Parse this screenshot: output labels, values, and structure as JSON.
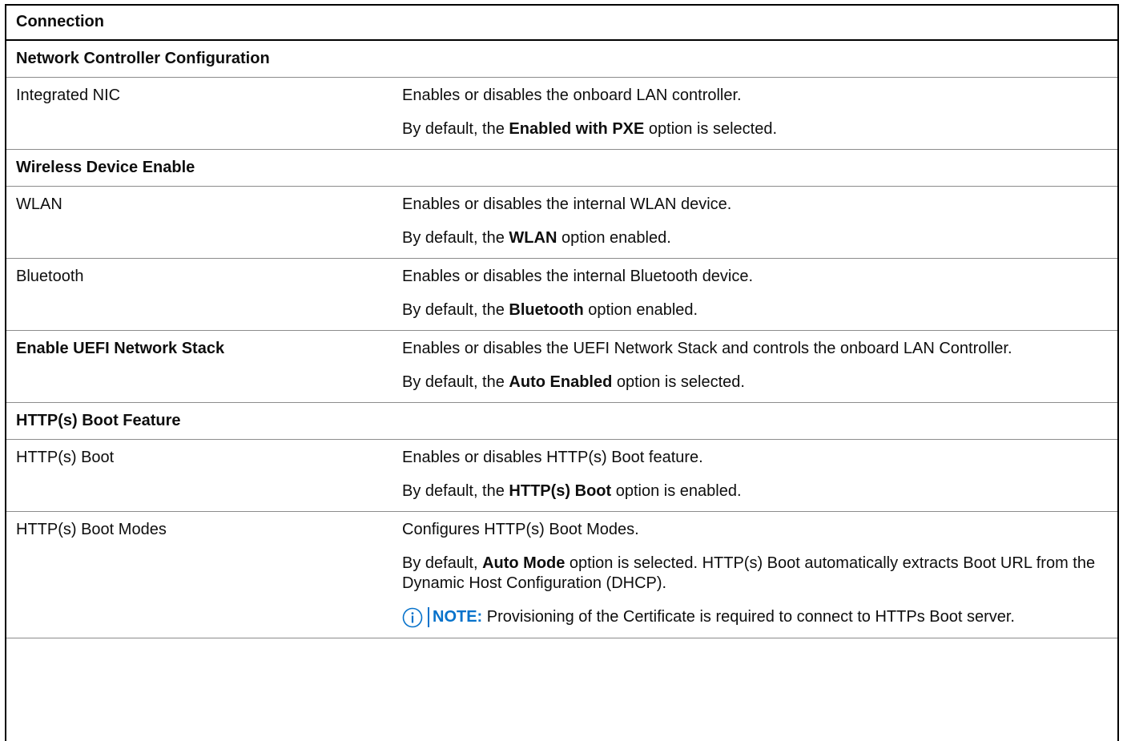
{
  "table": {
    "header": "Connection",
    "sections": [
      {
        "title": "Network Controller Configuration",
        "rows": [
          {
            "name": "Integrated NIC",
            "name_bold": false,
            "paragraphs": [
              {
                "pre": "Enables or disables the onboard LAN controller.",
                "bold": "",
                "post": ""
              },
              {
                "pre": "By default, the ",
                "bold": "Enabled with PXE",
                "post": " option is selected."
              }
            ]
          }
        ]
      },
      {
        "title": "Wireless Device Enable",
        "rows": [
          {
            "name": "WLAN",
            "name_bold": false,
            "paragraphs": [
              {
                "pre": "Enables or disables the internal WLAN device.",
                "bold": "",
                "post": ""
              },
              {
                "pre": "By default, the ",
                "bold": "WLAN",
                "post": " option enabled."
              }
            ]
          },
          {
            "name": "Bluetooth",
            "name_bold": false,
            "paragraphs": [
              {
                "pre": "Enables or disables the internal Bluetooth device.",
                "bold": "",
                "post": ""
              },
              {
                "pre": "By default, the ",
                "bold": "Bluetooth",
                "post": " option enabled."
              }
            ]
          },
          {
            "name": "Enable UEFI Network Stack",
            "name_bold": true,
            "paragraphs": [
              {
                "pre": "Enables or disables the UEFI Network Stack and controls the onboard LAN Controller.",
                "bold": "",
                "post": ""
              },
              {
                "pre": "By default, the ",
                "bold": "Auto Enabled",
                "post": " option is selected."
              }
            ]
          }
        ]
      },
      {
        "title": "HTTP(s) Boot Feature",
        "rows": [
          {
            "name": "HTTP(s) Boot",
            "name_bold": false,
            "paragraphs": [
              {
                "pre": "Enables or disables HTTP(s) Boot feature.",
                "bold": "",
                "post": ""
              },
              {
                "pre": "By default, the ",
                "bold": "HTTP(s) Boot",
                "post": " option is enabled."
              }
            ]
          },
          {
            "name": "HTTP(s) Boot Modes",
            "name_bold": false,
            "paragraphs": [
              {
                "pre": "Configures HTTP(s) Boot Modes.",
                "bold": "",
                "post": ""
              },
              {
                "pre": "By default, ",
                "bold": "Auto Mode",
                "post": " option is selected. HTTP(s) Boot automatically extracts Boot URL from the Dynamic Host Configuration (DHCP)."
              }
            ],
            "note": {
              "icon": "info-icon",
              "label": "NOTE:",
              "text": " Provisioning of the Certificate is required to connect to HTTPs Boot server."
            }
          }
        ]
      }
    ]
  },
  "colors": {
    "note_accent": "#0672cb",
    "text": "#0e0e0e",
    "row_border": "#8c8c8c"
  }
}
